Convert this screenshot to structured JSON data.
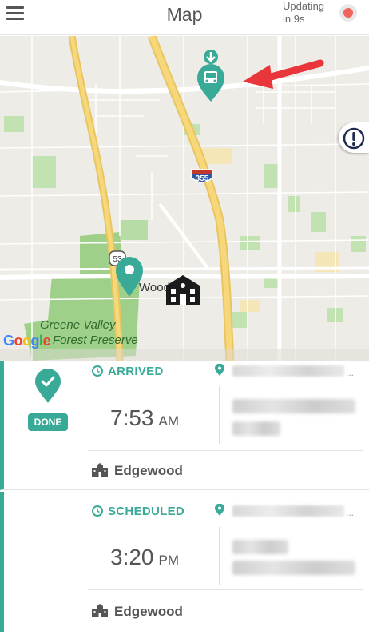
{
  "header": {
    "title": "Map",
    "updating_line1": "Updating",
    "updating_line2": "in 9s",
    "status_color": "#f0645c"
  },
  "map": {
    "park_label_1": "Greene Valley",
    "park_label_2": "Forest Preserve",
    "town_label": "Woodridge",
    "route_shield_1": "53",
    "route_shield_2": "355",
    "provider_logo": "Google",
    "icons": [
      "bus-marker-icon",
      "arrow-down-icon",
      "stop-pin-icon",
      "school-icon",
      "alert-icon"
    ],
    "accent_color": "#3aaa98",
    "annotation_arrow_color": "#e8363a"
  },
  "stops": [
    {
      "status": "ARRIVED",
      "badge": "DONE",
      "time": "7:53",
      "meridiem": "AM",
      "ellipsis": "...",
      "school": "Edgewood"
    },
    {
      "status": "SCHEDULED",
      "time": "3:20",
      "meridiem": "PM",
      "ellipsis": "...",
      "school": "Edgewood"
    }
  ]
}
